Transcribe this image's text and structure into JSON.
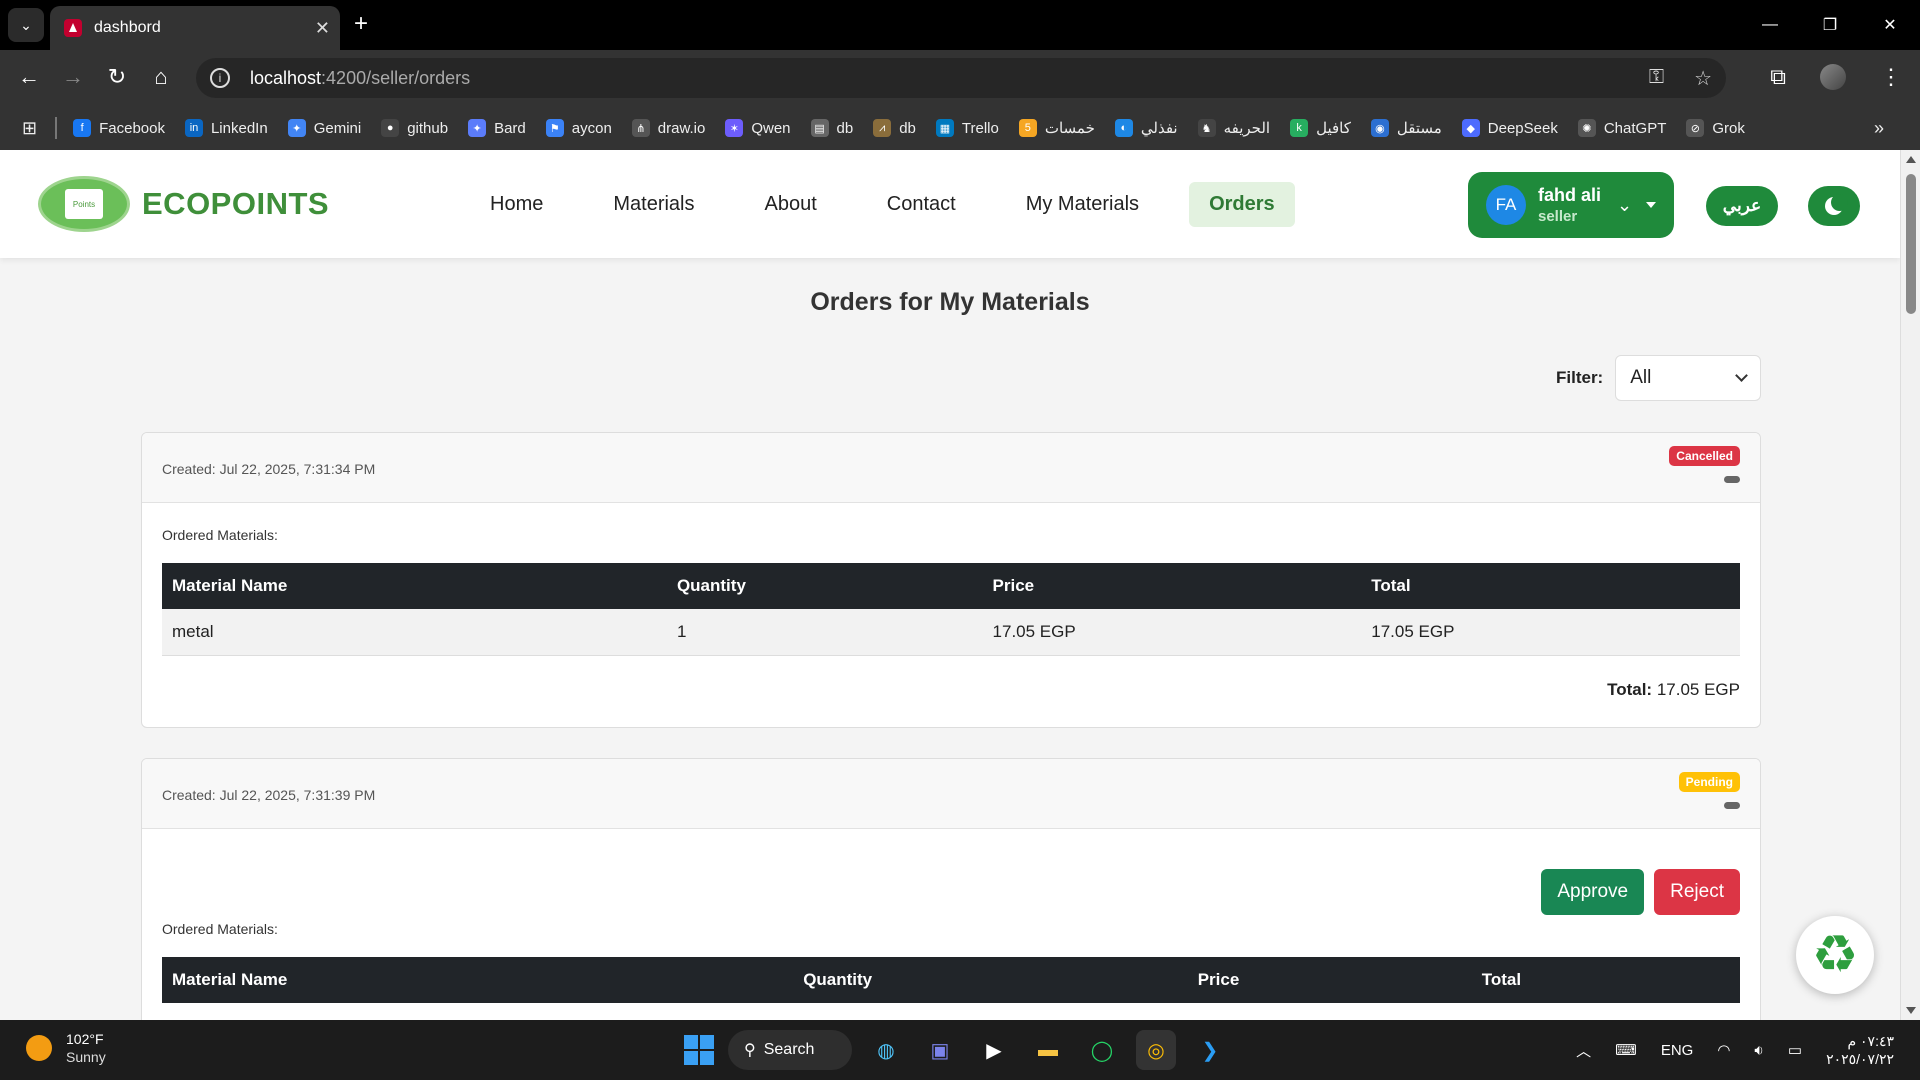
{
  "browser": {
    "tab_title": "dashbord",
    "url_host": "localhost",
    "url_path": ":4200/seller/orders",
    "bookmarks": [
      {
        "label": "Facebook",
        "color": "#1877f2",
        "glyph": "f"
      },
      {
        "label": "LinkedIn",
        "color": "#0a66c2",
        "glyph": "in"
      },
      {
        "label": "Gemini",
        "color": "#4285f4",
        "glyph": "✦"
      },
      {
        "label": "github",
        "color": "#444444",
        "glyph": "●"
      },
      {
        "label": "Bard",
        "color": "#5b7cfa",
        "glyph": "✦"
      },
      {
        "label": "aycon",
        "color": "#3b82f6",
        "glyph": "⚑"
      },
      {
        "label": "draw.io",
        "color": "#555555",
        "glyph": "⋔"
      },
      {
        "label": "Qwen",
        "color": "#6d5dfc",
        "glyph": "✶"
      },
      {
        "label": "db",
        "color": "#666666",
        "glyph": "▤"
      },
      {
        "label": "db",
        "color": "#8a6d3b",
        "glyph": "⩘"
      },
      {
        "label": "Trello",
        "color": "#0079bf",
        "glyph": "▦"
      },
      {
        "label": "خمسات",
        "color": "#f5a623",
        "glyph": "5"
      },
      {
        "label": "نفذلي",
        "color": "#1e88e5",
        "glyph": "◐"
      },
      {
        "label": "الحريفه",
        "color": "#444444",
        "glyph": "♞"
      },
      {
        "label": "كافيل",
        "color": "#27ae60",
        "glyph": "k"
      },
      {
        "label": "مستقل",
        "color": "#2c6fd1",
        "glyph": "◉"
      },
      {
        "label": "DeepSeek",
        "color": "#4d6bfe",
        "glyph": "◆"
      },
      {
        "label": "ChatGPT",
        "color": "#555555",
        "glyph": "✺"
      },
      {
        "label": "Grok",
        "color": "#555555",
        "glyph": "⊘"
      }
    ]
  },
  "header": {
    "logo_text": "ECOPOINTS",
    "logo_badge_text": "Points",
    "nav": [
      "Home",
      "Materials",
      "About",
      "Contact",
      "My Materials",
      "Orders"
    ],
    "active_nav": "Orders",
    "user_initials": "FA",
    "user_name": "fahd ali",
    "user_role": "seller",
    "lang_label": "عربي"
  },
  "main": {
    "title": "Orders for My Materials",
    "filter_label": "Filter:",
    "filter_value": "All",
    "ordered_label": "Ordered Materials:",
    "columns": [
      "Material Name",
      "Quantity",
      "Price",
      "Total"
    ],
    "orders": [
      {
        "created": "Created: Jul 22, 2025, 7:31:34 PM",
        "status": "Cancelled",
        "rows": [
          [
            "metal",
            "1",
            "17.05 EGP",
            "17.05 EGP"
          ]
        ],
        "total_label": "Total:",
        "total_value": "17.05 EGP"
      },
      {
        "created": "Created: Jul 22, 2025, 7:31:39 PM",
        "status": "Pending",
        "approve_label": "Approve",
        "reject_label": "Reject"
      }
    ]
  },
  "taskbar": {
    "temp": "102°F",
    "condition": "Sunny",
    "search_label": "Search",
    "lang": "ENG",
    "time": "٠٧:٤٣ م",
    "date": "٢٠٢٥/٠٧/٢٢"
  },
  "colors": {
    "brand_green": "#1f8a3b",
    "cancelled": "#dc3545",
    "pending": "#ffc107",
    "approve": "#198754",
    "reject": "#dc3545"
  }
}
